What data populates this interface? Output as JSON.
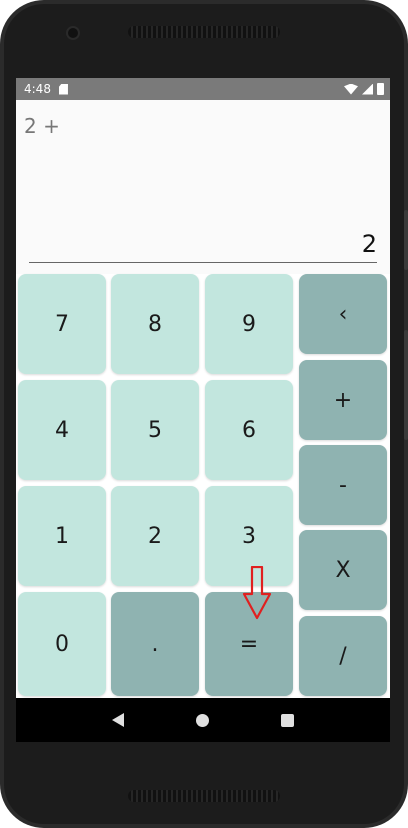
{
  "status_bar": {
    "time": "4:48"
  },
  "display": {
    "expression": "2 +",
    "result": "2"
  },
  "keys": {
    "seven": "7",
    "eight": "8",
    "nine": "9",
    "backspace": "‹",
    "four": "4",
    "five": "5",
    "six": "6",
    "plus": "+",
    "one": "1",
    "two": "2",
    "three": "3",
    "minus": "-",
    "zero": "0",
    "dot": ".",
    "equals": "=",
    "multiply": "X",
    "divide": "/"
  },
  "colors": {
    "number_key": "#c2e6de",
    "operator_key": "#8fb3b1",
    "annotation_arrow": "#e02020"
  },
  "icons": [
    "sd-card-icon",
    "wifi-icon",
    "signal-icon",
    "battery-icon",
    "back-icon",
    "home-icon",
    "recents-icon",
    "down-arrow-icon"
  ]
}
